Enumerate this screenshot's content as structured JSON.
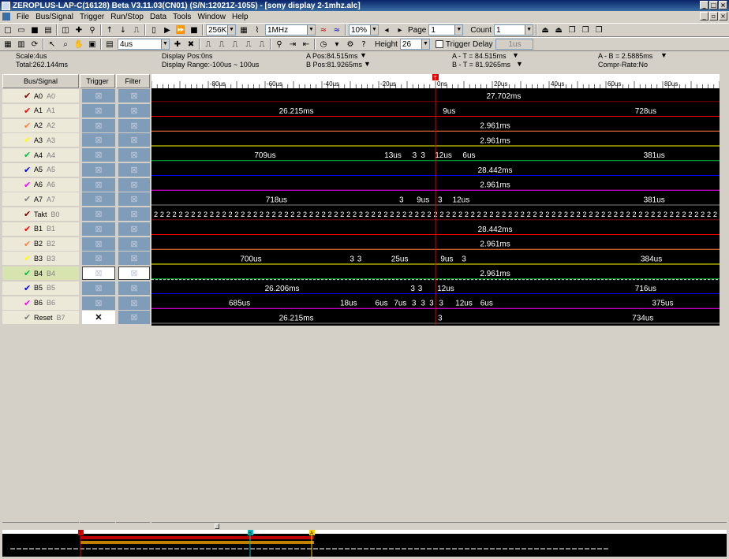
{
  "window": {
    "title": "ZEROPLUS-LAP-C(16128) Beta V3.11.03(CN01) (S/N:12021Z-1055) - [sony display 2-1mhz.alc]"
  },
  "menu": [
    "File",
    "Bus/Signal",
    "Trigger",
    "Run/Stop",
    "Data",
    "Tools",
    "Window",
    "Help"
  ],
  "toolbar1": {
    "memory_depth": "256K",
    "sample_rate": "1MHz",
    "trigger_pos": "10%",
    "page_label": "Page",
    "page_value": "1",
    "count_label": "Count",
    "count_value": "1"
  },
  "toolbar2": {
    "zoom_value": "4us",
    "height_label": "Height",
    "height_value": "26",
    "trigger_delay_label": "Trigger Delay",
    "trigger_delay_value": "1us"
  },
  "info": {
    "scale": "Scale:4us",
    "total": "Total:262.144ms",
    "display_pos": "Display Pos:0ns",
    "display_range": "Display Range:-100us ~ 100us",
    "a_pos": "A Pos:84.515ms",
    "b_pos": "B Pos:81.9265ms",
    "a_minus_t": "A - T = 84.515ms",
    "b_minus_t": "B - T = 81.9265ms",
    "a_minus_b": "A - B = 2.5885ms",
    "compr_rate": "Compr-Rate:No"
  },
  "columns": {
    "signal": "Bus/Signal",
    "trigger": "Trigger",
    "filter": "Filter"
  },
  "ruler_labels": [
    "-80us",
    "-60us",
    "-40us",
    "-20us",
    "0ns",
    "20us",
    "40us",
    "60us",
    "80us"
  ],
  "trigger_marker": "T",
  "signals": [
    {
      "name": "A0",
      "alias": "A0",
      "color": "#800000"
    },
    {
      "name": "A1",
      "alias": "A1",
      "color": "#ff0000"
    },
    {
      "name": "A2",
      "alias": "A2",
      "color": "#ff8040"
    },
    {
      "name": "A3",
      "alias": "A3",
      "color": "#ffff00"
    },
    {
      "name": "A4",
      "alias": "A4",
      "color": "#00c040"
    },
    {
      "name": "A5",
      "alias": "A5",
      "color": "#0000ff"
    },
    {
      "name": "A6",
      "alias": "A6",
      "color": "#ff00ff"
    },
    {
      "name": "A7",
      "alias": "A7",
      "color": "#808080"
    },
    {
      "name": "Takt",
      "alias": "B0",
      "color": "#800000"
    },
    {
      "name": "B1",
      "alias": "B1",
      "color": "#ff0000"
    },
    {
      "name": "B2",
      "alias": "B2",
      "color": "#ff8040"
    },
    {
      "name": "B3",
      "alias": "B3",
      "color": "#ffff00"
    },
    {
      "name": "B4",
      "alias": "B4",
      "color": "#00c040"
    },
    {
      "name": "B5",
      "alias": "B5",
      "color": "#0000ff"
    },
    {
      "name": "B6",
      "alias": "B6",
      "color": "#ff00ff"
    },
    {
      "name": "Reset",
      "alias": "B7",
      "color": "#808080"
    }
  ],
  "waves": [
    {
      "color": "#800000",
      "labels": [
        {
          "t": 0.62,
          "text": "27.702ms"
        }
      ]
    },
    {
      "color": "#ff0000",
      "labels": [
        {
          "t": 0.255,
          "text": "26.215ms"
        },
        {
          "t": 0.524,
          "text": "9us"
        },
        {
          "t": 0.87,
          "text": "728us"
        }
      ]
    },
    {
      "color": "#ff8040",
      "labels": [
        {
          "t": 0.605,
          "text": "2.961ms"
        }
      ]
    },
    {
      "color": "#ffff00",
      "labels": [
        {
          "t": 0.605,
          "text": "2.961ms"
        }
      ]
    },
    {
      "color": "#00c040",
      "labels": [
        {
          "t": 0.2,
          "text": "709us"
        },
        {
          "t": 0.425,
          "text": "13us"
        },
        {
          "t": 0.463,
          "text": "3"
        },
        {
          "t": 0.478,
          "text": "3"
        },
        {
          "t": 0.514,
          "text": "12us"
        },
        {
          "t": 0.559,
          "text": "6us"
        },
        {
          "t": 0.885,
          "text": "381us"
        }
      ]
    },
    {
      "color": "#0000ff",
      "labels": [
        {
          "t": 0.605,
          "text": "28.442ms"
        }
      ]
    },
    {
      "color": "#ff00ff",
      "labels": [
        {
          "t": 0.605,
          "text": "2.961ms"
        }
      ]
    },
    {
      "color": "#808080",
      "labels": [
        {
          "t": 0.22,
          "text": "718us"
        },
        {
          "t": 0.44,
          "text": "3"
        },
        {
          "t": 0.478,
          "text": "9us"
        },
        {
          "t": 0.508,
          "text": "3"
        },
        {
          "t": 0.545,
          "text": "12us"
        },
        {
          "t": 0.885,
          "text": "381us"
        }
      ]
    },
    {
      "color": "#800000",
      "labels": [
        {
          "t": 0.5,
          "text": "2 2 2 2 2 2 2 2 2 2 2 2 2 2 2 2 2 2 2 2 2 2 2 2 2 2 2 2 2 2 2 2 2 2 2 2 2 2 2 2 2 2 2 2 2 2 2 2 2 2 2 2 2 2 2 2 2 2 2 2 2 2 2 2 2 2 2 2 2 2 2 2 2 2 2 2 2 2 2 2 2 2 2 2 2 2 2 2 2 2 2"
        }
      ]
    },
    {
      "color": "#ff0000",
      "labels": [
        {
          "t": 0.605,
          "text": "28.442ms"
        }
      ]
    },
    {
      "color": "#ff8040",
      "labels": [
        {
          "t": 0.605,
          "text": "2.961ms"
        }
      ]
    },
    {
      "color": "#ffff00",
      "labels": [
        {
          "t": 0.175,
          "text": "700us"
        },
        {
          "t": 0.353,
          "text": "3"
        },
        {
          "t": 0.366,
          "text": "3"
        },
        {
          "t": 0.437,
          "text": "25us"
        },
        {
          "t": 0.52,
          "text": "9us"
        },
        {
          "t": 0.55,
          "text": "3"
        },
        {
          "t": 0.88,
          "text": "384us"
        }
      ]
    },
    {
      "color": "#00c040",
      "labels": [
        {
          "t": 0.605,
          "text": "2.961ms"
        }
      ]
    },
    {
      "color": "#0000ff",
      "labels": [
        {
          "t": 0.23,
          "text": "26.206ms"
        },
        {
          "t": 0.46,
          "text": "3"
        },
        {
          "t": 0.473,
          "text": "3"
        },
        {
          "t": 0.518,
          "text": "12us"
        },
        {
          "t": 0.87,
          "text": "716us"
        }
      ]
    },
    {
      "color": "#ff00ff",
      "labels": [
        {
          "t": 0.155,
          "text": "685us"
        },
        {
          "t": 0.347,
          "text": "18us"
        },
        {
          "t": 0.405,
          "text": "6us"
        },
        {
          "t": 0.438,
          "text": "7us"
        },
        {
          "t": 0.462,
          "text": "3"
        },
        {
          "t": 0.478,
          "text": "3"
        },
        {
          "t": 0.493,
          "text": "3"
        },
        {
          "t": 0.51,
          "text": "3"
        },
        {
          "t": 0.55,
          "text": "12us"
        },
        {
          "t": 0.59,
          "text": "6us"
        },
        {
          "t": 0.9,
          "text": "375us"
        }
      ]
    },
    {
      "color": "#808080",
      "labels": [
        {
          "t": 0.255,
          "text": "26.215ms"
        },
        {
          "t": 0.508,
          "text": "3"
        },
        {
          "t": 0.865,
          "text": "734us"
        }
      ]
    }
  ],
  "overview_markers": [
    "T",
    "B",
    "A"
  ]
}
